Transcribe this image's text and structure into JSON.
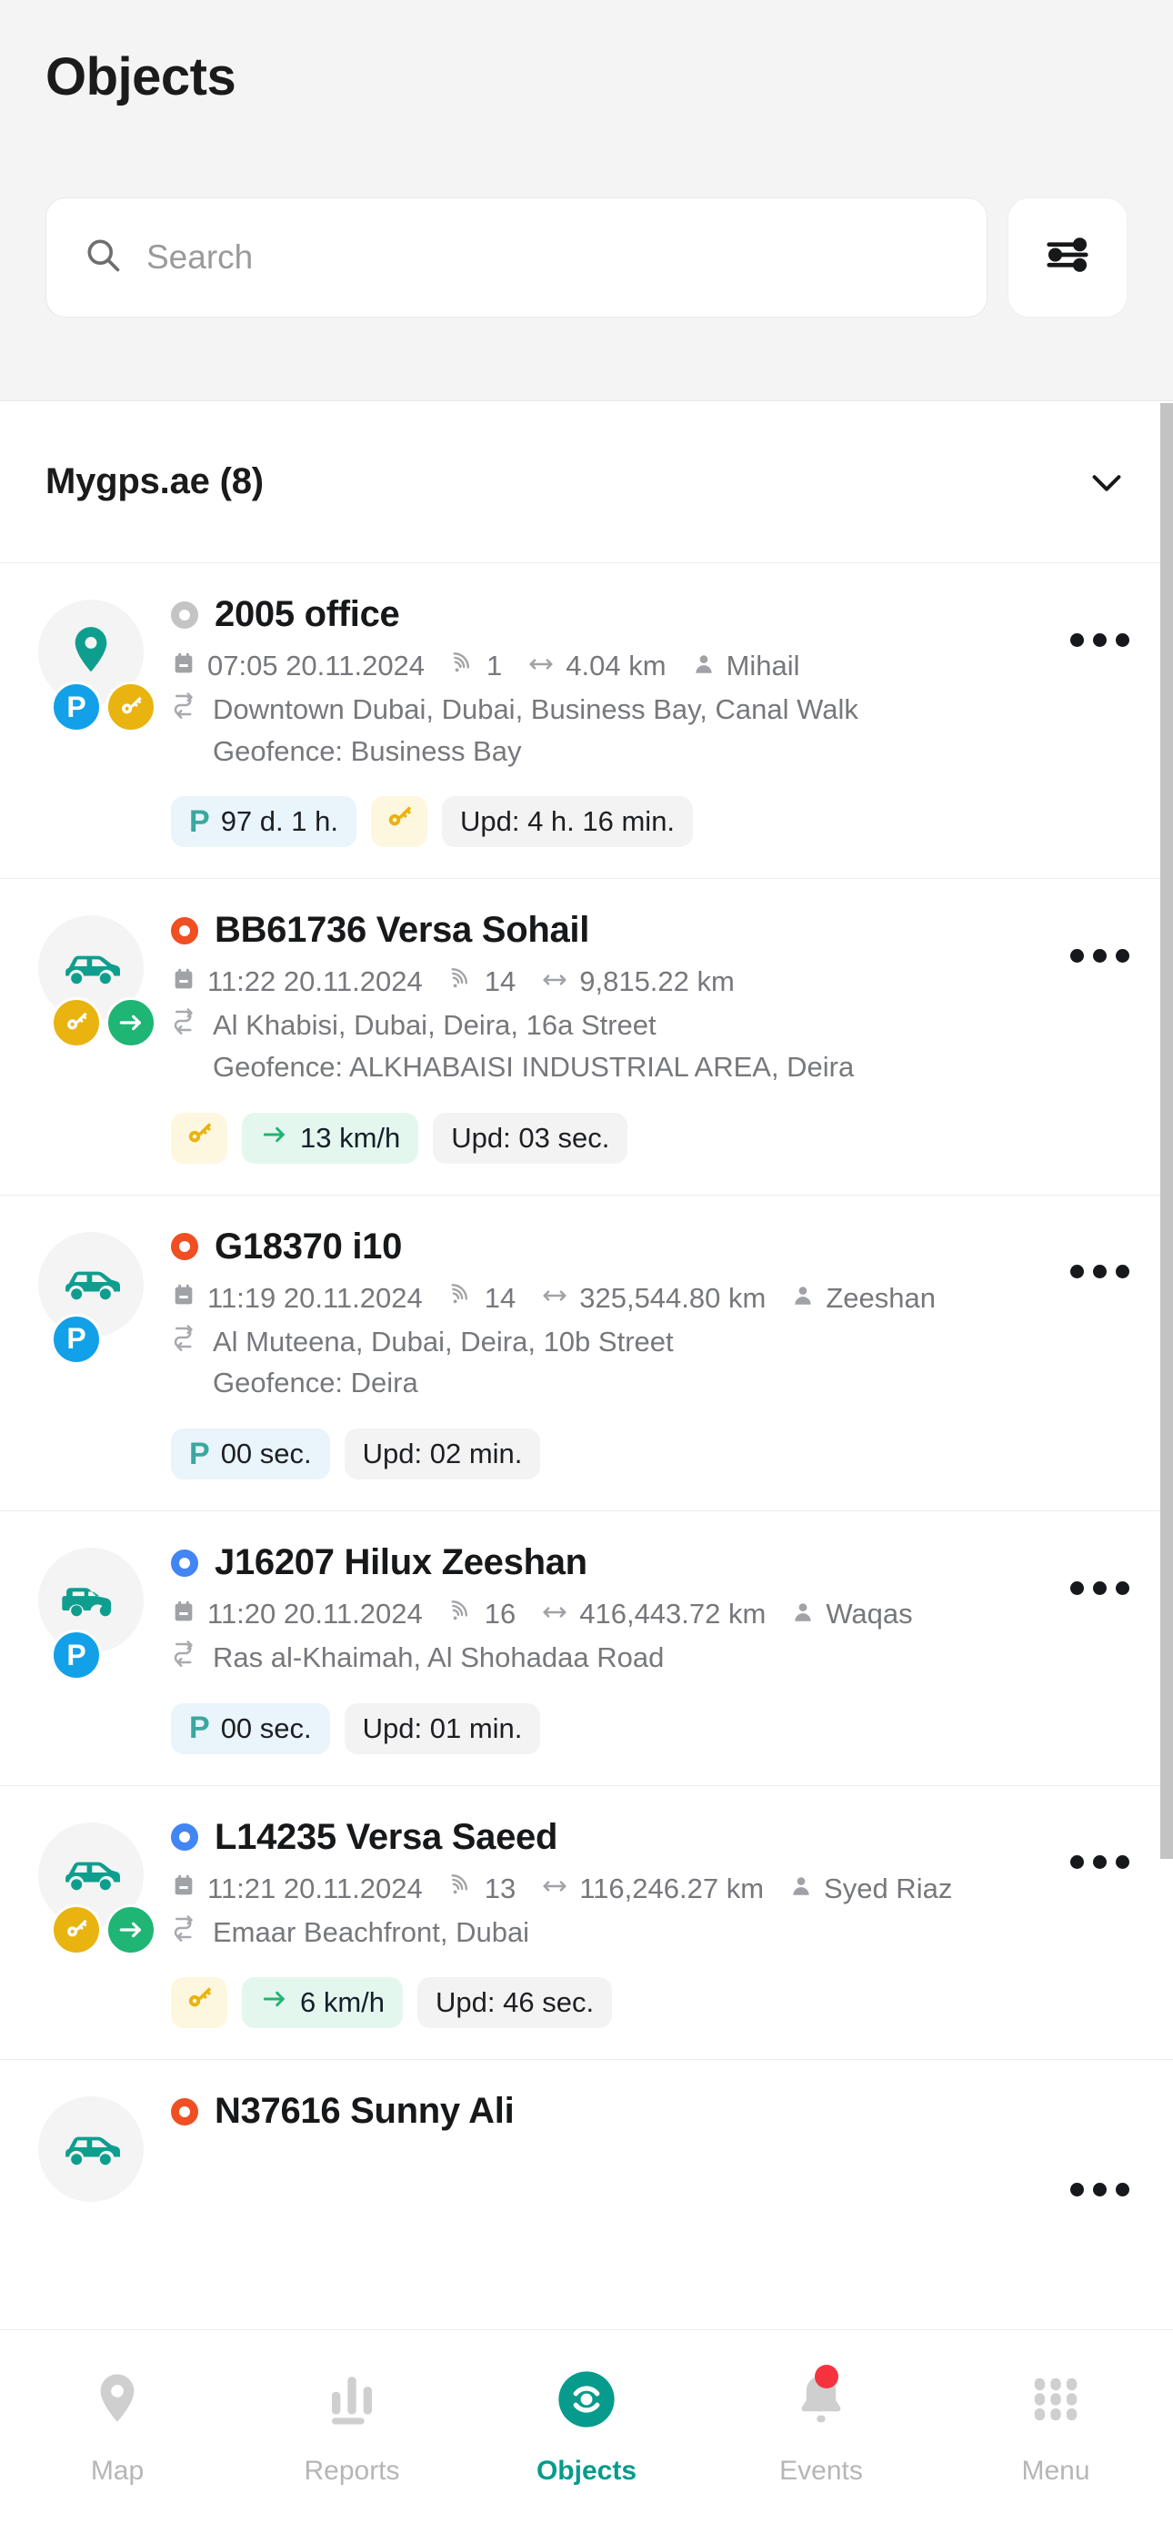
{
  "header": {
    "title": "Objects",
    "search": {
      "value": "",
      "placeholder": "Search"
    },
    "filter_icon": "sliders-filter-icon"
  },
  "group": {
    "label": "Mygps.ae (8)",
    "chevron_icon": "chevron-down-icon",
    "expanded": true
  },
  "colors": {
    "accent_teal": "#069B8C",
    "status_red": "#F04E23",
    "status_blue": "#4285F4",
    "status_gray": "#c4c4c4",
    "badge_park_blue": "#12A1E8",
    "badge_key_yellow": "#E9B310",
    "badge_move_green": "#1FB574",
    "event_badge_red": "#F5333F",
    "background": "#f4f4f4"
  },
  "objects": [
    {
      "name": "2005 office",
      "status": "gray",
      "vehicle_icon": "map-pin-icon",
      "badges": [
        "parking",
        "key"
      ],
      "datetime": "07:05 20.11.2024",
      "satellites": "1",
      "distance": "4.04 km",
      "driver": "Mihail",
      "address": "Downtown Dubai, Dubai, Business Bay, Canal Walk",
      "geofence": "Geofence: Business Bay",
      "chips": [
        {
          "type": "park",
          "glyph": "P",
          "text": "97 d. 1 h."
        },
        {
          "type": "key",
          "glyph": "key-icon",
          "text": ""
        },
        {
          "type": "upd",
          "glyph": "",
          "text": "Upd: 4 h. 16 min."
        }
      ],
      "more_icon": "more-horizontal-icon"
    },
    {
      "name": "BB61736 Versa Sohail",
      "status": "red",
      "vehicle_icon": "car-sedan-icon",
      "badges": [
        "key",
        "moving"
      ],
      "datetime": "11:22 20.11.2024",
      "satellites": "14",
      "distance": "9,815.22 km",
      "driver": "",
      "address": "Al Khabisi, Dubai, Deira, 16a Street",
      "geofence": "Geofence: ALKHABAISI INDUSTRIAL AREA, Deira",
      "chips": [
        {
          "type": "key",
          "glyph": "key-icon",
          "text": ""
        },
        {
          "type": "speed",
          "glyph": "arrow-right-icon",
          "text": "13 km/h"
        },
        {
          "type": "upd",
          "glyph": "",
          "text": "Upd: 03 sec."
        }
      ],
      "more_icon": "more-horizontal-icon"
    },
    {
      "name": "G18370 i10",
      "status": "red",
      "vehicle_icon": "car-sedan-icon",
      "badges": [
        "parking"
      ],
      "datetime": "11:19 20.11.2024",
      "satellites": "14",
      "distance": "325,544.80 km",
      "driver": "Zeeshan",
      "address": "Al Muteena, Dubai, Deira, 10b Street",
      "geofence": "Geofence: Deira",
      "chips": [
        {
          "type": "park",
          "glyph": "P",
          "text": "00 sec."
        },
        {
          "type": "upd",
          "glyph": "",
          "text": "Upd: 02 min."
        }
      ],
      "more_icon": "more-horizontal-icon"
    },
    {
      "name": "J16207 Hilux Zeeshan",
      "status": "blue",
      "vehicle_icon": "pickup-truck-icon",
      "badges": [
        "parking"
      ],
      "datetime": "11:20 20.11.2024",
      "satellites": "16",
      "distance": "416,443.72 km",
      "driver": "Waqas",
      "address": "Ras al-Khaimah, Al Shohadaa Road",
      "geofence": "",
      "chips": [
        {
          "type": "park",
          "glyph": "P",
          "text": "00 sec."
        },
        {
          "type": "upd",
          "glyph": "",
          "text": "Upd: 01 min."
        }
      ],
      "more_icon": "more-horizontal-icon"
    },
    {
      "name": "L14235 Versa Saeed",
      "status": "blue",
      "vehicle_icon": "car-sedan-icon",
      "badges": [
        "key",
        "moving"
      ],
      "datetime": "11:21 20.11.2024",
      "satellites": "13",
      "distance": "116,246.27 km",
      "driver": "Syed Riaz",
      "address": "Emaar Beachfront, Dubai",
      "geofence": "",
      "chips": [
        {
          "type": "key",
          "glyph": "key-icon",
          "text": ""
        },
        {
          "type": "speed",
          "glyph": "arrow-right-icon",
          "text": "6 km/h"
        },
        {
          "type": "upd",
          "glyph": "",
          "text": "Upd: 46 sec."
        }
      ],
      "more_icon": "more-horizontal-icon"
    },
    {
      "name": "N37616 Sunny Ali",
      "status": "red",
      "vehicle_icon": "car-sedan-icon",
      "badges": [],
      "datetime": "",
      "satellites": "",
      "distance": "",
      "driver": "",
      "address": "",
      "geofence": "",
      "chips": [],
      "more_icon": "more-horizontal-icon"
    }
  ],
  "bottom_nav": {
    "items": [
      {
        "label": "Map",
        "icon": "map-pin-icon",
        "active": false,
        "badge": false
      },
      {
        "label": "Reports",
        "icon": "bar-chart-icon",
        "active": false,
        "badge": false
      },
      {
        "label": "Objects",
        "icon": "target-icon",
        "active": true,
        "badge": false
      },
      {
        "label": "Events",
        "icon": "bell-icon",
        "active": false,
        "badge": true
      },
      {
        "label": "Menu",
        "icon": "grid-menu-icon",
        "active": false,
        "badge": false
      }
    ]
  }
}
